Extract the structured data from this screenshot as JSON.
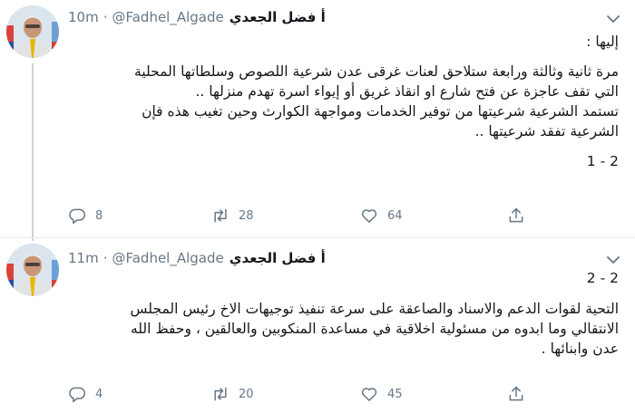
{
  "tweets": [
    {
      "name": "أ فضل الجعدي",
      "handle": "@Fadhel_Algade",
      "dot": "·",
      "time": "10m",
      "lines": [
        "إليها :",
        "مرة ثانية وثالثة ورابعة ستلاحق لعنات غرقى عدن شرعية اللصوص وسلطاتها المحلية",
        "التي تقف عاجزة عن فتح شارع او انقاذ غريق أو إيواء اسرة تهدم منزلها ..",
        "تستمد الشرعية شرعيتها من توفير الخدمات ومواجهة الكوارث وحين تغيب هذه فإن",
        "الشرعية تفقد شرعيتها ..",
        "2 - 1"
      ],
      "stats": {
        "replies": "8",
        "retweets": "28",
        "likes": "64"
      }
    },
    {
      "name": "أ فضل الجعدي",
      "handle": "@Fadhel_Algade",
      "dot": "·",
      "time": "11m",
      "lines": [
        "2 - 2",
        "التحية لقوات الدعم والاسناد والصاعقة على سرعة تنفيذ توجيهات الاخ رئيس المجلس",
        "الانتقالي وما ابدوه من مسئولية اخلاقية في مساعدة المنكوبين والعالقين ، وحفظ الله",
        "عدن وابنائها ."
      ],
      "stats": {
        "replies": "4",
        "retweets": "20",
        "likes": "45"
      }
    }
  ],
  "icons": {
    "caret": "chevron-down-icon",
    "reply": "reply-icon",
    "retweet": "retweet-icon",
    "like": "like-icon",
    "share": "share-icon"
  },
  "colors": {
    "text": "#14171a",
    "secondary": "#657786",
    "divider": "#e6ecf0",
    "thread": "#ccd6dd"
  }
}
